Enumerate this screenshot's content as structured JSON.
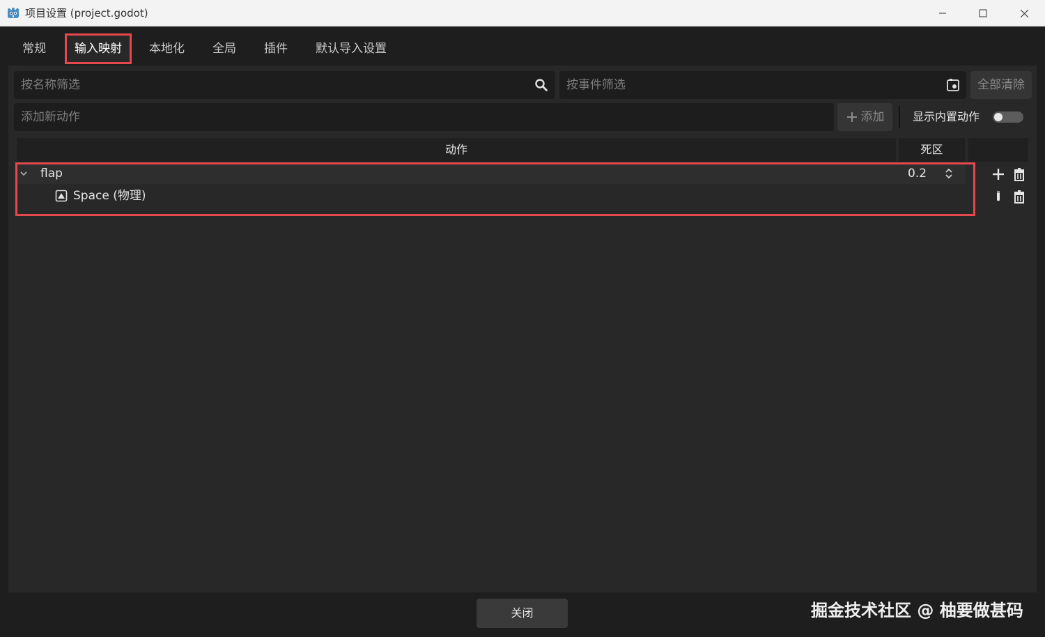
{
  "window": {
    "title": "项目设置 (project.godot)",
    "icon": "godot-icon"
  },
  "tabs": [
    {
      "label": "常规",
      "active": false
    },
    {
      "label": "输入映射",
      "active": true
    },
    {
      "label": "本地化",
      "active": false
    },
    {
      "label": "全局",
      "active": false
    },
    {
      "label": "插件",
      "active": false
    },
    {
      "label": "默认导入设置",
      "active": false
    }
  ],
  "filters": {
    "name_placeholder": "按名称筛选",
    "event_placeholder": "按事件筛选",
    "clear_all_label": "全部清除"
  },
  "add_action": {
    "placeholder": "添加新动作",
    "add_label": "添加",
    "show_builtin_label": "显示内置动作",
    "show_builtin_enabled": false
  },
  "table": {
    "col_action": "动作",
    "col_deadzone": "死区",
    "actions": [
      {
        "name": "flap",
        "deadzone": "0.2",
        "expanded": true,
        "events": [
          {
            "label": "Space (物理)",
            "icon": "keyboard-icon"
          }
        ]
      }
    ]
  },
  "footer": {
    "close_label": "关闭",
    "watermark": "掘金技术社区 @ 柚要做甚码"
  },
  "colors": {
    "highlight": "#e5484d",
    "panel": "#282828",
    "background": "#1e1e1e"
  }
}
